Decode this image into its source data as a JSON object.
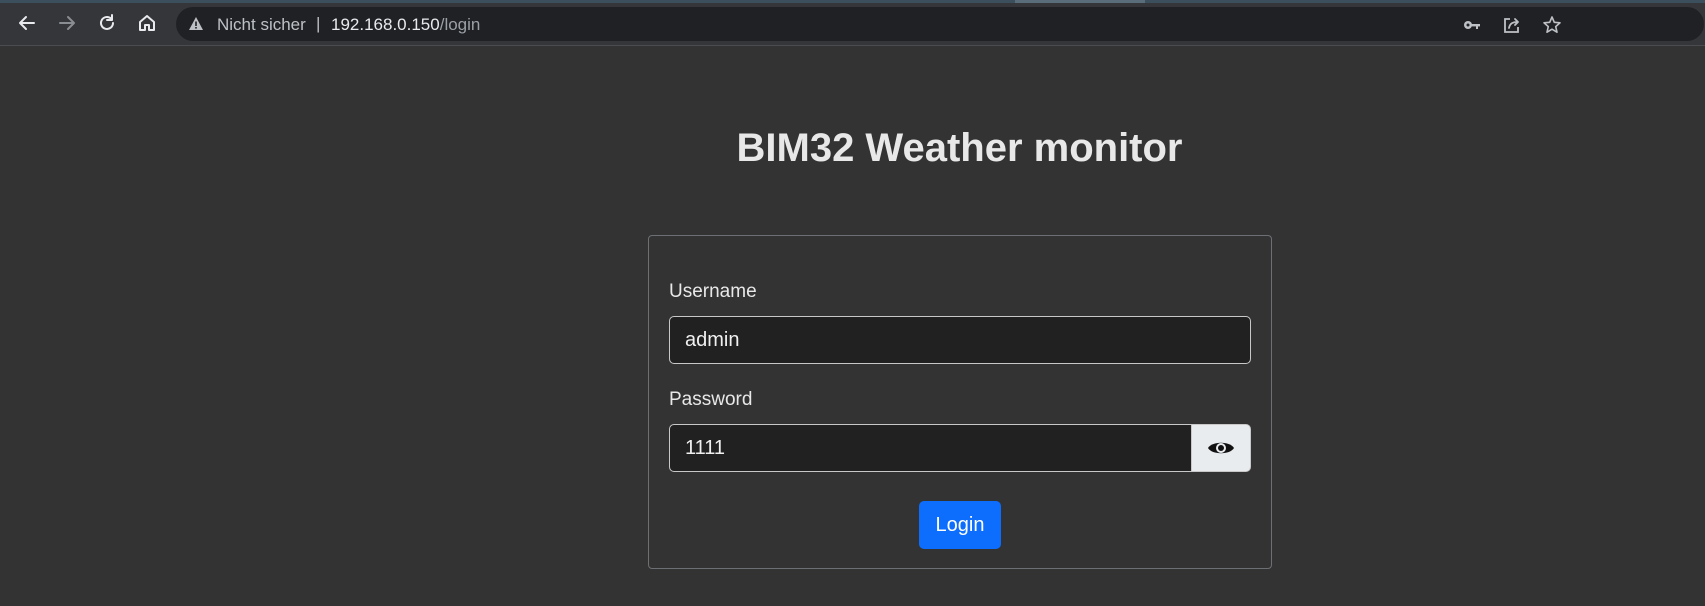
{
  "browser": {
    "security_label": "Nicht sicher",
    "separator": "|",
    "url_host": "192.168.0.150",
    "url_path": "/login",
    "icons": {
      "back": "back-arrow-icon",
      "forward": "forward-arrow-icon",
      "reload": "reload-icon",
      "home": "home-icon",
      "warning": "warning-triangle-icon",
      "key": "key-icon",
      "share": "share-icon",
      "bookmark": "star-icon"
    }
  },
  "page": {
    "title": "BIM32 Weather monitor"
  },
  "form": {
    "username_label": "Username",
    "username_value": "admin",
    "password_label": "Password",
    "password_value": "1111",
    "toggle_icon": "eye-icon",
    "login_label": "Login"
  },
  "colors": {
    "page_background": "#333333",
    "primary_button": "#0d6efd",
    "input_background": "#212121"
  }
}
